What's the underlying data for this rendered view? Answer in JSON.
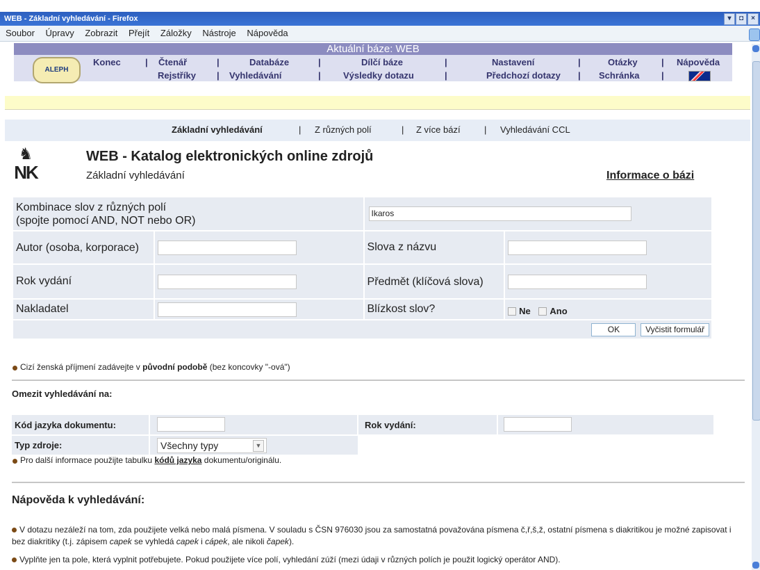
{
  "window": {
    "title": "WEB - Základní vyhledávání - Firefox"
  },
  "menu": [
    "Soubor",
    "Úpravy",
    "Zobrazit",
    "Přejít",
    "Záložky",
    "Nástroje",
    "Nápověda"
  ],
  "top": {
    "base": "Aktuální báze: WEB",
    "logo": "ALEPH",
    "row1": [
      "Konec",
      "Čtenář",
      "Databáze",
      "Dílčí báze",
      "Nastavení",
      "Otázky",
      "Nápověda"
    ],
    "row2": [
      "Rejstříky",
      "Vyhledávání",
      "Výsledky dotazu",
      "Předchozí dotazy",
      "Schránka"
    ]
  },
  "subnav": [
    "Základní vyhledávání",
    "Z různých polí",
    "Z více bází",
    "Vyhledávání CCL"
  ],
  "header": {
    "title": "WEB - Katalog elektronických online zdrojů",
    "subtitle": "Základní vyhledávání",
    "info": "Informace o bázi",
    "nk": "NK"
  },
  "form": {
    "combo_label": "Kombinace slov z různých polí",
    "combo_sub": "(spojte pomocí AND, NOT nebo OR)",
    "combo_value": "Ikaros",
    "author": "Autor (osoba, korporace)",
    "title_words": "Slova z názvu",
    "year": "Rok vydání",
    "subject": "Předmět (klíčová slova)",
    "publisher": "Nakladatel",
    "proximity": "Blízkost slov?",
    "prox_no": "Ne",
    "prox_yes": "Ano",
    "ok": "OK",
    "clear": "Vyčistit formulář"
  },
  "notes": {
    "note1_pre": "Cizí ženská příjmení zadávejte v ",
    "note1_bold": "původní podobě",
    "note1_post": " (bez koncovky \"-ová\")",
    "limit_title": "Omezit vyhledávání na:",
    "lang": "Kód jazyka dokumentu:",
    "year2": "Rok vydání:",
    "type": "Typ zdroje:",
    "type_value": "Všechny typy",
    "note2_pre": "Pro další informace použijte tabulku ",
    "note2_bold": "kódů jazyka",
    "note2_post": " dokumentu/originálu."
  },
  "help": {
    "title": "Nápověda k vyhledávání:",
    "p1_a": "V dotazu nezáleží na tom, zda použijete velká nebo malá písmena. V souladu s ČSN 976030 jsou za samostatná považována písmena č,ř,š,ž, ostatní písmena s diakritikou je možné zapisovat i bez diakritiky (t.j. zápisem ",
    "p1_b": "capek",
    "p1_c": " se vyhledá ",
    "p1_d": "capek",
    "p1_e": " i ",
    "p1_f": "cápek",
    "p1_g": ", ale nikoli ",
    "p1_h": "čapek",
    "p1_i": ").",
    "p2": "Vyplňte jen ta pole, která vyplnit potřebujete. Pokud použijete více polí, vyhledání zúží (mezi údaji v různých polích je použit logický operátor AND)."
  }
}
